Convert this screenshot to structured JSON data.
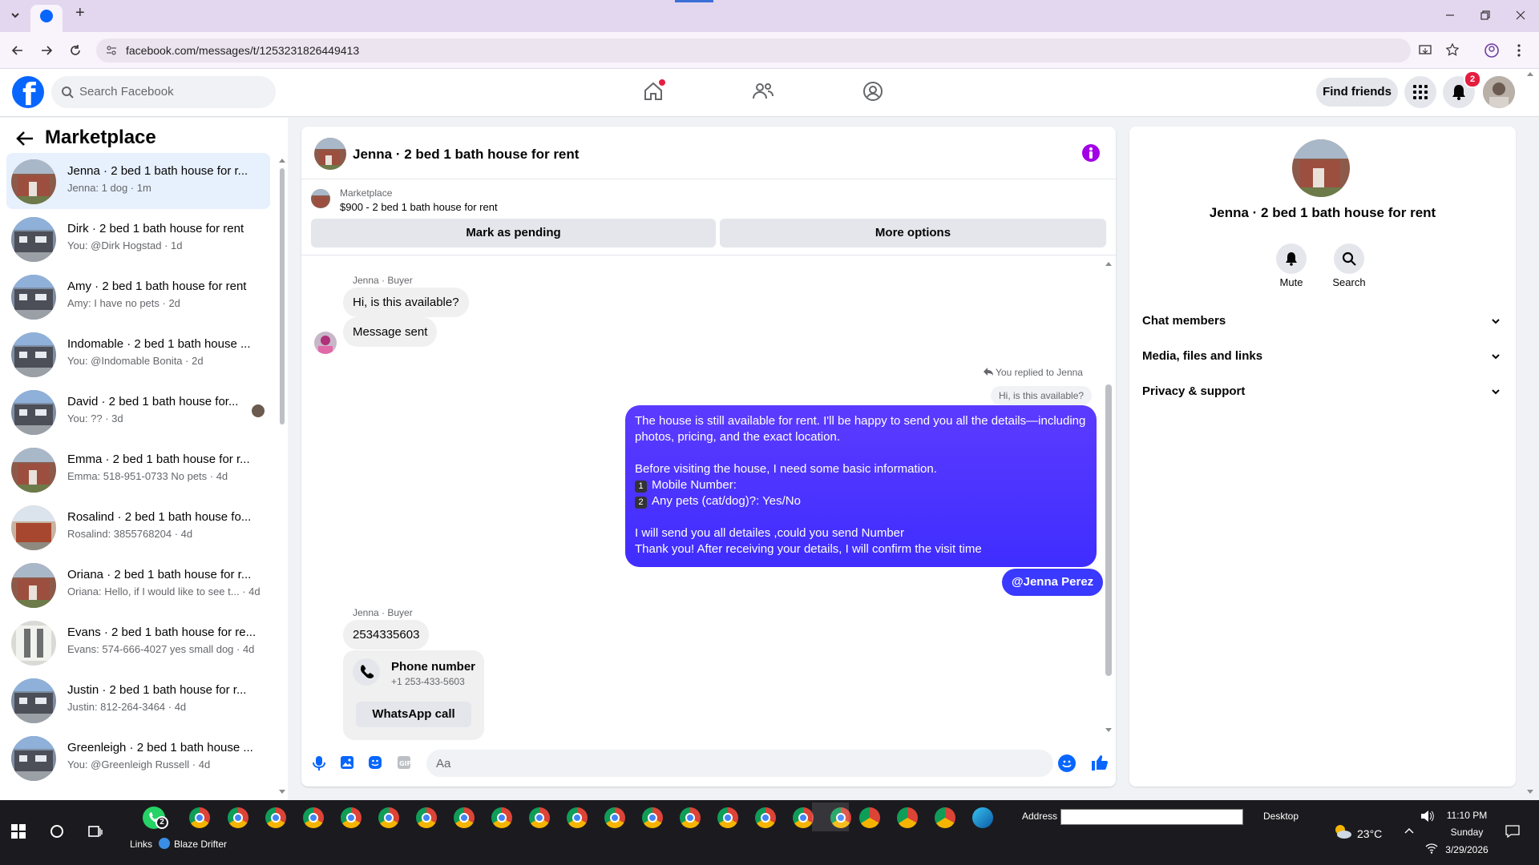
{
  "browser": {
    "url": "facebook.com/messages/t/1253231826449413",
    "new_tab": "+",
    "tab_icon": "facebook-icon"
  },
  "fb_header": {
    "search_placeholder": "Search Facebook",
    "find_friends": "Find friends",
    "notifications_count": "2"
  },
  "sidebar": {
    "title": "Marketplace",
    "conversations": [
      {
        "name": "Jenna · 2 bed 1 bath house for r...",
        "sub": "Jenna: 1 dog · 1m",
        "active": true,
        "thumb": "brick"
      },
      {
        "name": "Dirk · 2 bed 1 bath house for rent",
        "sub": "You: @Dirk Hogstad · 1d",
        "thumb": "gray"
      },
      {
        "name": "Amy · 2 bed 1 bath house for rent",
        "sub": "Amy: I have no pets · 2d",
        "thumb": "gray"
      },
      {
        "name": "Indomable · 2 bed 1 bath house ...",
        "sub": "You: @Indomable Bonita · 2d",
        "thumb": "gray"
      },
      {
        "name": "David · 2 bed 1 bath house for...",
        "sub": "You: ?? · 3d",
        "thumb": "gray"
      },
      {
        "name": "Emma · 2 bed 1 bath house for r...",
        "sub": "Emma: 518-951-0733 No pets · 4d",
        "thumb": "brick"
      },
      {
        "name": "Rosalind · 2 bed 1 bath house fo...",
        "sub": "Rosalind: 3855768204 · 4d",
        "thumb": "brick2"
      },
      {
        "name": "Oriana · 2 bed 1 bath house for r...",
        "sub": "Oriana: Hello, if I would like to see t... · 4d",
        "thumb": "brick"
      },
      {
        "name": "Evans · 2 bed 1 bath house for re...",
        "sub": "Evans: 574-666-4027 yes small dog · 4d",
        "thumb": "white"
      },
      {
        "name": "Justin · 2 bed 1 bath house for r...",
        "sub": "Justin: 812-264-3464 · 4d",
        "thumb": "gray"
      },
      {
        "name": "Greenleigh · 2 bed 1 bath house ...",
        "sub": "You: @Greenleigh Russell · 4d",
        "thumb": "gray"
      }
    ]
  },
  "chat": {
    "title": "Jenna · 2 bed 1 bath house for rent",
    "marketplace_label": "Marketplace",
    "listing": "$900 - 2 bed 1 bath house for rent",
    "mark_pending": "Mark as pending",
    "more_options": "More options",
    "msg1_meta": "Jenna · Buyer",
    "msg1_a": "Hi, is this available?",
    "msg1_b": "Message sent",
    "reply_meta": "You replied to Jenna",
    "reply_quote": "Hi, is this available?",
    "out_lines": [
      "The house is still available for rent. I'll be happy to send you all the details—including photos, pricing, and the exact location.",
      "Before visiting the house, I need some basic information.",
      "Mobile Number:",
      "Any pets (cat/dog)?: Yes/No",
      "I will send you all detailes ,could you send Number",
      "Thank you! After receiving your details, I will confirm the visit time"
    ],
    "out_num1": "1",
    "out_num2": "2",
    "mention": "@Jenna Perez",
    "msg2_meta": "Jenna · Buyer",
    "msg2_text": "2534335603",
    "phone_title": "Phone number",
    "phone_number": "+1 253-433-5603",
    "whatsapp": "WhatsApp call",
    "composer_placeholder": "Aa"
  },
  "right_panel": {
    "title": "Jenna · 2 bed 1 bath house for rent",
    "mute": "Mute",
    "search": "Search",
    "sections": [
      "Chat members",
      "Media, files and links",
      "Privacy & support"
    ]
  },
  "taskbar": {
    "links": "Links",
    "blaze": "Blaze Drifter",
    "address": "Address",
    "desktop": "Desktop",
    "weather": "23°C",
    "time": "11:10 PM",
    "day": "Sunday",
    "date": "3/29/2026",
    "whatsapp_badge": "2"
  },
  "colors": {
    "fb_blue": "#0866ff",
    "outgoing_bubble": "#4a34ff",
    "active_row": "#e7f0fd",
    "badge_red": "#e41e3f"
  }
}
